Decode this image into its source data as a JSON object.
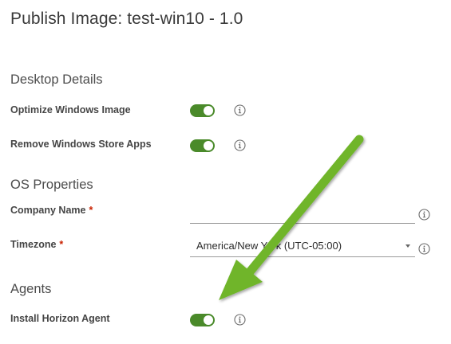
{
  "page": {
    "title": "Publish Image: test-win10 - 1.0"
  },
  "sections": {
    "desktop_details": {
      "heading": "Desktop Details",
      "optimize_label": "Optimize Windows Image",
      "optimize_on": true,
      "remove_store_label": "Remove Windows Store Apps",
      "remove_store_on": true
    },
    "os_properties": {
      "heading": "OS Properties",
      "company_label": "Company Name",
      "company_value": "",
      "company_required": "*",
      "timezone_label": "Timezone",
      "timezone_required": "*",
      "timezone_value": "America/New York (UTC-05:00)"
    },
    "agents": {
      "heading": "Agents",
      "horizon_label": "Install Horizon Agent",
      "horizon_on": true
    }
  },
  "colors": {
    "toggle_on": "#4a8a2a",
    "required": "#c92100",
    "annotation_arrow": "#6fb52c"
  },
  "icons": {
    "info": "info-circle-icon",
    "caret": "caret-down-icon",
    "annotation": "green-pointer-arrow"
  }
}
